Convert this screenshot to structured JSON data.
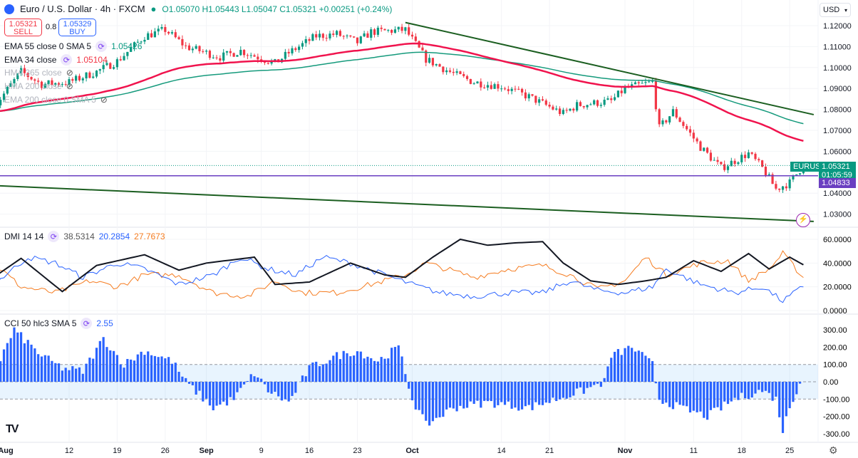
{
  "header": {
    "symbol": "Euro / U.S. Dollar · 4h · FXCM",
    "open": "O1.05070",
    "high": "H1.05443",
    "low": "L1.05047",
    "close": "C1.05321",
    "change": "+0.00251 (+0.24%)"
  },
  "trade": {
    "sell_price": "1.05321",
    "sell_label": "SELL",
    "spread": "0.8",
    "buy_price": "1.05329",
    "buy_label": "BUY"
  },
  "legend": {
    "ema55": {
      "label": "EMA 55 close 0 SMA 5",
      "value": "1.05426"
    },
    "ema34": {
      "label": "EMA 34 close",
      "value": "1.05104"
    },
    "hma365": {
      "label": "HMA 365 close"
    },
    "hma200": {
      "label": "HMA 200 close"
    },
    "ema200": {
      "label": "EMA 200 close 0 SMA 5"
    },
    "dmi": {
      "label": "DMI 14 14",
      "adx": "38.5314",
      "plus": "20.2854",
      "minus": "27.7673"
    },
    "cci": {
      "label": "CCI 50 hlc3 SMA 5",
      "value": "2.55"
    }
  },
  "currency": "USD",
  "badges": {
    "symbol": "EURUSD",
    "last": "1.05321",
    "countdown": "01:05:59",
    "hline": "1.04833"
  },
  "colors": {
    "up": "#089981",
    "down": "#f23645",
    "ema34": "#f0134d",
    "ema55": "#159a7c",
    "trend": "#1b5e20",
    "hline": "#6a3fc1",
    "adx": "#131722",
    "plus": "#2962ff",
    "minus": "#f57c20",
    "cci": "#2962ff"
  },
  "chart_data": {
    "type": "candlestick",
    "title": "Euro / U.S. Dollar · 4h · FXCM",
    "price_ticks": [
      "1.12000",
      "1.11000",
      "1.10000",
      "1.09000",
      "1.08000",
      "1.07000",
      "1.06000",
      "1.04000",
      "1.03000"
    ],
    "price_range": [
      1.0235,
      1.1245
    ],
    "x_ticks": [
      {
        "day": 0,
        "label": "Aug"
      },
      {
        "day": 11,
        "label": "12"
      },
      {
        "day": 18,
        "label": "19"
      },
      {
        "day": 25,
        "label": "26"
      },
      {
        "day": 31,
        "label": "Sep"
      },
      {
        "day": 39,
        "label": "9"
      },
      {
        "day": 46,
        "label": "16"
      },
      {
        "day": 53,
        "label": "23"
      },
      {
        "day": 61,
        "label": "Oct"
      },
      {
        "day": 74,
        "label": "14"
      },
      {
        "day": 81,
        "label": "21"
      },
      {
        "day": 92,
        "label": "Nov"
      },
      {
        "day": 102,
        "label": "11"
      },
      {
        "day": 109,
        "label": "18"
      },
      {
        "day": 116,
        "label": "25"
      }
    ],
    "x_unit": "days since Aug 1",
    "price_path": [
      [
        0,
        1.081
      ],
      [
        4,
        1.098
      ],
      [
        7,
        1.092
      ],
      [
        11,
        1.093
      ],
      [
        15,
        1.098
      ],
      [
        18,
        1.103
      ],
      [
        22,
        1.115
      ],
      [
        25,
        1.118
      ],
      [
        28,
        1.11
      ],
      [
        33,
        1.105
      ],
      [
        36,
        1.108
      ],
      [
        41,
        1.102
      ],
      [
        43,
        1.107
      ],
      [
        47,
        1.115
      ],
      [
        50,
        1.116
      ],
      [
        53,
        1.112
      ],
      [
        55,
        1.117
      ],
      [
        60,
        1.118
      ],
      [
        63,
        1.104
      ],
      [
        67,
        1.097
      ],
      [
        70,
        1.093
      ],
      [
        74,
        1.091
      ],
      [
        78,
        1.086
      ],
      [
        83,
        1.078
      ],
      [
        85,
        1.082
      ],
      [
        90,
        1.084
      ],
      [
        92,
        1.09
      ],
      [
        96,
        1.093
      ],
      [
        97,
        1.071
      ],
      [
        99,
        1.079
      ],
      [
        103,
        1.062
      ],
      [
        106,
        1.052
      ],
      [
        110,
        1.059
      ],
      [
        112,
        1.052
      ],
      [
        114,
        1.042
      ],
      [
        116,
        1.045
      ],
      [
        118,
        1.0532
      ]
    ],
    "trendlines": [
      {
        "from": [
          60,
          1.1215
        ],
        "to": [
          119.5,
          1.0775
        ]
      },
      {
        "from": [
          -1,
          1.0438
        ],
        "to": [
          119.5,
          1.0265
        ]
      }
    ],
    "horizontal_line": 1.04833,
    "dmi": {
      "range": [
        0,
        65
      ],
      "ticks": [
        "60.0000",
        "40.0000",
        "20.0000",
        "0.0000"
      ],
      "adx": [
        [
          0,
          28
        ],
        [
          4,
          44
        ],
        [
          10,
          16
        ],
        [
          15,
          38
        ],
        [
          22,
          47
        ],
        [
          27,
          34
        ],
        [
          31,
          40
        ],
        [
          38,
          45
        ],
        [
          41,
          22
        ],
        [
          46,
          24
        ],
        [
          52,
          40
        ],
        [
          57,
          30
        ],
        [
          60,
          28
        ],
        [
          64,
          45
        ],
        [
          68,
          60
        ],
        [
          72,
          55
        ],
        [
          76,
          57
        ],
        [
          80,
          58
        ],
        [
          83,
          40
        ],
        [
          87,
          25
        ],
        [
          91,
          22
        ],
        [
          95,
          25
        ],
        [
          98,
          28
        ],
        [
          102,
          42
        ],
        [
          106,
          33
        ],
        [
          110,
          48
        ],
        [
          113,
          35
        ],
        [
          116,
          45
        ],
        [
          118,
          38.5
        ]
      ],
      "plus": [
        [
          0,
          22
        ],
        [
          5,
          45
        ],
        [
          9,
          40
        ],
        [
          13,
          28
        ],
        [
          18,
          40
        ],
        [
          22,
          35
        ],
        [
          27,
          22
        ],
        [
          32,
          30
        ],
        [
          36,
          45
        ],
        [
          40,
          35
        ],
        [
          44,
          30
        ],
        [
          48,
          45
        ],
        [
          52,
          40
        ],
        [
          57,
          30
        ],
        [
          61,
          22
        ],
        [
          65,
          15
        ],
        [
          70,
          12
        ],
        [
          75,
          15
        ],
        [
          80,
          15
        ],
        [
          84,
          25
        ],
        [
          88,
          17
        ],
        [
          92,
          15
        ],
        [
          96,
          20
        ],
        [
          98,
          35
        ],
        [
          103,
          22
        ],
        [
          108,
          15
        ],
        [
          112,
          20
        ],
        [
          115,
          8
        ],
        [
          118,
          20.3
        ]
      ],
      "minus": [
        [
          0,
          40
        ],
        [
          4,
          20
        ],
        [
          9,
          15
        ],
        [
          14,
          25
        ],
        [
          18,
          20
        ],
        [
          22,
          30
        ],
        [
          27,
          30
        ],
        [
          32,
          15
        ],
        [
          37,
          12
        ],
        [
          41,
          25
        ],
        [
          45,
          15
        ],
        [
          50,
          15
        ],
        [
          55,
          22
        ],
        [
          60,
          30
        ],
        [
          63,
          40
        ],
        [
          66,
          35
        ],
        [
          70,
          28
        ],
        [
          75,
          35
        ],
        [
          80,
          38
        ],
        [
          84,
          30
        ],
        [
          88,
          18
        ],
        [
          92,
          25
        ],
        [
          95,
          45
        ],
        [
          98,
          30
        ],
        [
          103,
          40
        ],
        [
          107,
          42
        ],
        [
          110,
          25
        ],
        [
          113,
          35
        ],
        [
          115,
          48
        ],
        [
          118,
          27.8
        ]
      ]
    },
    "cci": {
      "range": [
        -330,
        330
      ],
      "ticks": [
        "300.00",
        "200.00",
        "100.00",
        "0.00",
        "-100.00",
        "-200.00",
        "-300.00"
      ],
      "bands": [
        100,
        -100
      ],
      "values": [
        [
          0,
          50
        ],
        [
          3,
          300
        ],
        [
          7,
          150
        ],
        [
          10,
          80
        ],
        [
          13,
          60
        ],
        [
          16,
          250
        ],
        [
          19,
          100
        ],
        [
          22,
          180
        ],
        [
          26,
          120
        ],
        [
          28,
          0
        ],
        [
          32,
          -150
        ],
        [
          35,
          -100
        ],
        [
          38,
          50
        ],
        [
          40,
          -50
        ],
        [
          43,
          -120
        ],
        [
          46,
          80
        ],
        [
          50,
          150
        ],
        [
          53,
          180
        ],
        [
          56,
          120
        ],
        [
          59,
          200
        ],
        [
          61,
          -100
        ],
        [
          63,
          -250
        ],
        [
          67,
          -150
        ],
        [
          72,
          -120
        ],
        [
          78,
          -150
        ],
        [
          82,
          -100
        ],
        [
          86,
          -50
        ],
        [
          89,
          0
        ],
        [
          90,
          150
        ],
        [
          93,
          200
        ],
        [
          96,
          100
        ],
        [
          97,
          -100
        ],
        [
          100,
          -150
        ],
        [
          104,
          -200
        ],
        [
          108,
          -100
        ],
        [
          112,
          -50
        ],
        [
          114,
          -100
        ],
        [
          115,
          -280
        ],
        [
          116,
          -150
        ],
        [
          117.5,
          2.55
        ]
      ]
    }
  }
}
